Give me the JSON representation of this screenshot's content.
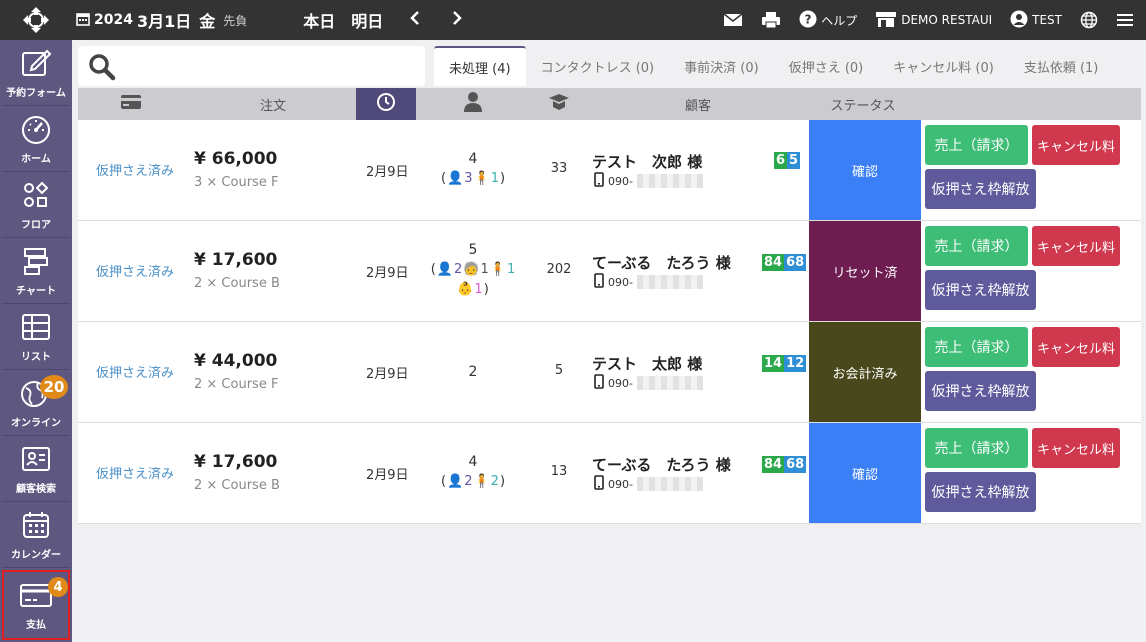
{
  "header": {
    "year": "2024",
    "month_day": "3月1日",
    "weekday": "金",
    "rokuyo": "先負",
    "today_label": "本日",
    "tomorrow_label": "明日",
    "help_label": "ヘルプ",
    "restaurant_label": "DEMO RESTAUI",
    "user_label": "TEST"
  },
  "sidebar": {
    "items": [
      {
        "label": "予約フォーム"
      },
      {
        "label": "ホーム"
      },
      {
        "label": "フロア"
      },
      {
        "label": "チャート"
      },
      {
        "label": "リスト"
      },
      {
        "label": "オンライン",
        "badge": "20"
      },
      {
        "label": "顧客検索"
      },
      {
        "label": "カレンダー"
      },
      {
        "label": "支払",
        "badge": "4"
      }
    ]
  },
  "tabs": [
    {
      "label": "未処理 (4)"
    },
    {
      "label": "コンタクトレス (0)"
    },
    {
      "label": "事前決済 (0)"
    },
    {
      "label": "仮押さえ (0)"
    },
    {
      "label": "キャンセル料 (0)"
    },
    {
      "label": "支払依頼 (1)"
    }
  ],
  "table_header": {
    "order": "注文",
    "customer": "顧客",
    "status": "ステータス"
  },
  "buttons": {
    "charge": "売上（請求）",
    "cancel_fee": "キャンセル料",
    "release": "仮押さえ枠解放"
  },
  "rows": [
    {
      "status": "仮押さえ済み",
      "price": "¥ 66,000",
      "course": "3 × Course F",
      "date": "2月9日",
      "total": "4",
      "adults": "3",
      "seniors": "",
      "kids": "1",
      "babies": "",
      "table": "33",
      "name": "テスト　次郎 様",
      "phone": "090-",
      "pts1": "6",
      "pts2": "5",
      "state": "確認",
      "state_color": "#3a7ff5"
    },
    {
      "status": "仮押さえ済み",
      "price": "¥ 17,600",
      "course": "2 × Course B",
      "date": "2月9日",
      "total": "5",
      "adults": "2",
      "seniors": "1",
      "kids": "1",
      "babies": "1",
      "table": "202",
      "name": "てーぶる　たろう 様",
      "phone": "090-",
      "pts1": "84",
      "pts2": "68",
      "state": "リセット済",
      "state_color": "#6e1d50"
    },
    {
      "status": "仮押さえ済み",
      "price": "¥ 44,000",
      "course": "2 × Course F",
      "date": "2月9日",
      "total": "2",
      "adults": "",
      "seniors": "",
      "kids": "",
      "babies": "",
      "table": "5",
      "name": "テスト　太郎 様",
      "phone": "090-",
      "pts1": "14",
      "pts2": "12",
      "state": "お会計済み",
      "state_color": "#48481c"
    },
    {
      "status": "仮押さえ済み",
      "price": "¥ 17,600",
      "course": "2 × Course B",
      "date": "2月9日",
      "total": "4",
      "adults": "2",
      "seniors": "",
      "kids": "2",
      "babies": "",
      "table": "13",
      "name": "てーぶる　たろう 様",
      "phone": "090-",
      "pts1": "84",
      "pts2": "68",
      "state": "確認",
      "state_color": "#3a7ff5"
    }
  ]
}
